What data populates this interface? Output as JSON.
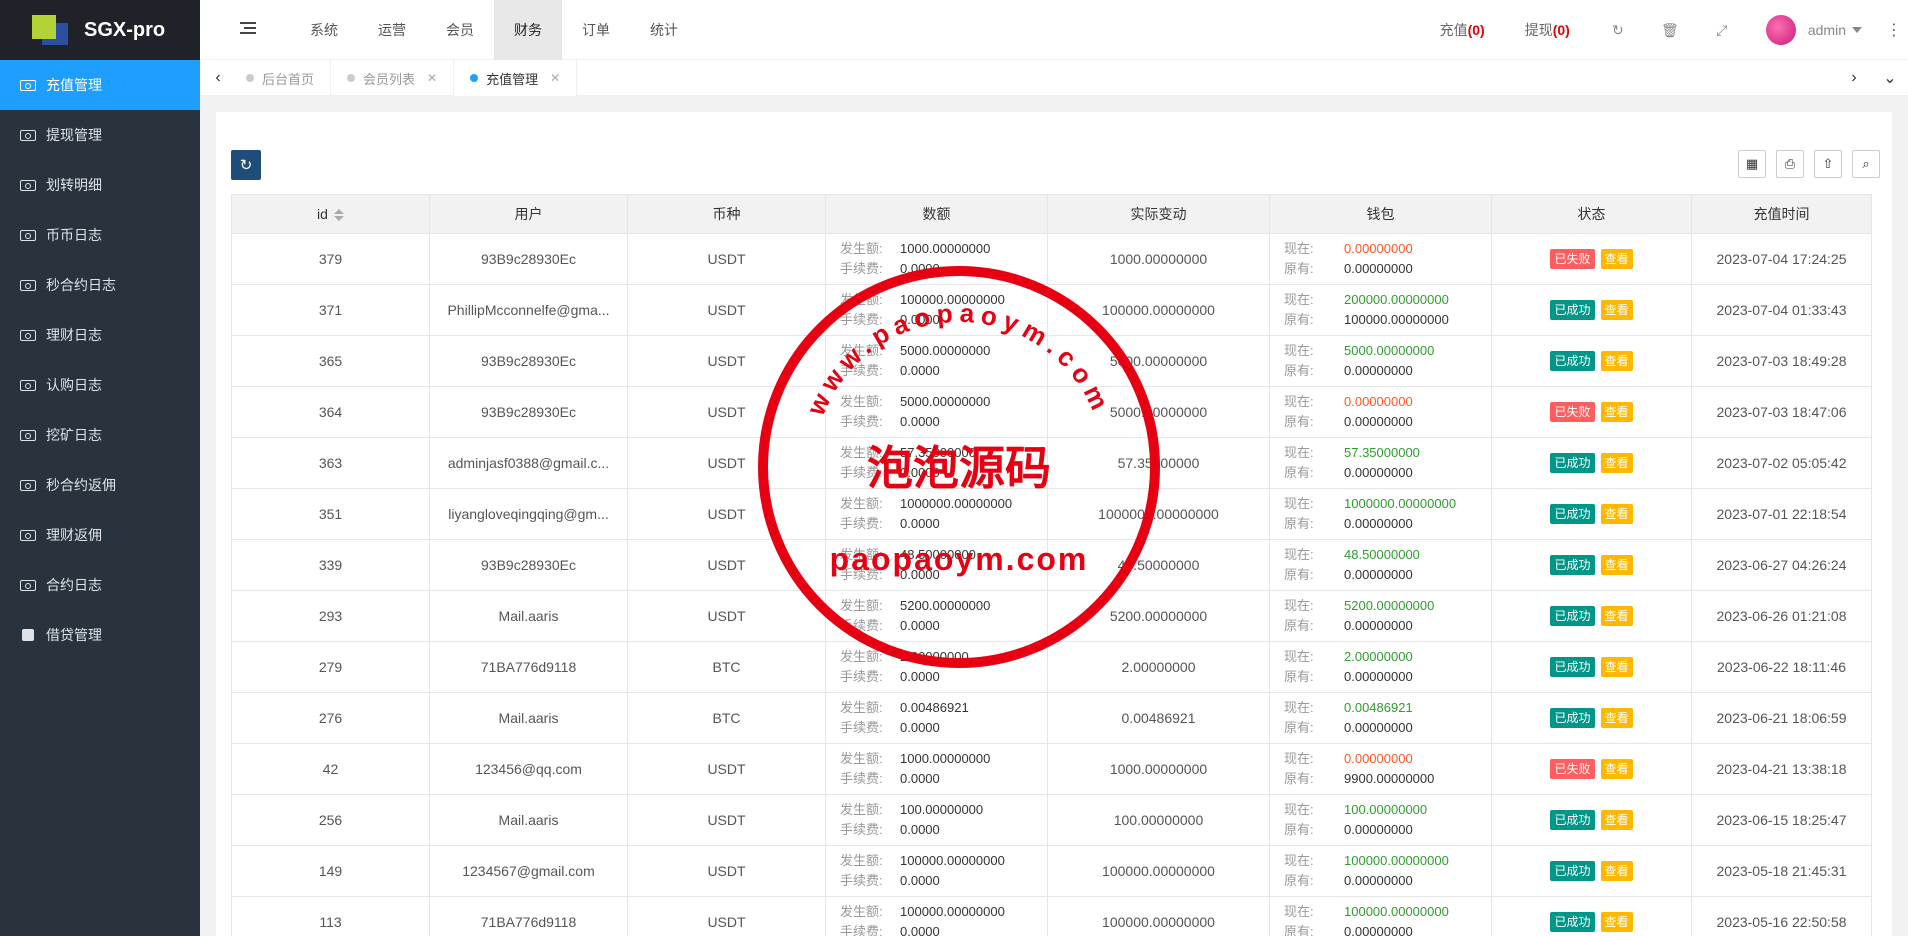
{
  "app": {
    "title": "SGX-pro"
  },
  "sidebar": {
    "items": [
      {
        "label": "充值管理",
        "active": true
      },
      {
        "label": "提现管理"
      },
      {
        "label": "划转明细"
      },
      {
        "label": "币币日志"
      },
      {
        "label": "秒合约日志"
      },
      {
        "label": "理财日志"
      },
      {
        "label": "认购日志"
      },
      {
        "label": "挖矿日志"
      },
      {
        "label": "秒合约返佣"
      },
      {
        "label": "理财返佣"
      },
      {
        "label": "合约日志"
      },
      {
        "label": "借贷管理"
      }
    ]
  },
  "topnav": {
    "items": [
      "系统",
      "运营",
      "会员",
      "财务",
      "订单",
      "统计"
    ],
    "active": "财务"
  },
  "header": {
    "recharge_label": "充值",
    "recharge_count": "(0)",
    "withdraw_label": "提现",
    "withdraw_count": "(0)",
    "user": "admin",
    "icons": [
      "refresh-icon",
      "trash-icon",
      "fullscreen-icon",
      "more-icon"
    ]
  },
  "tabs": [
    {
      "label": "后台首页",
      "closable": false
    },
    {
      "label": "会员列表",
      "closable": true
    },
    {
      "label": "充值管理",
      "closable": true,
      "active": true
    }
  ],
  "table": {
    "columns": [
      "id",
      "用户",
      "币种",
      "数额",
      "实际变动",
      "钱包",
      "状态",
      "充值时间"
    ],
    "amount_labels": {
      "occurred": "发生额:",
      "fee": "手续费:"
    },
    "wallet_labels": {
      "now": "现在:",
      "before": "原有:"
    },
    "status_labels": {
      "success": "已成功",
      "fail": "已失败",
      "view": "查看"
    },
    "rows": [
      {
        "id": "379",
        "user": "93B9c28930Ec",
        "coin": "USDT",
        "amount": "1000.00000000",
        "fee": "0.0000",
        "change": "1000.00000000",
        "now": "0.00000000",
        "before": "0.00000000",
        "status": "fail",
        "time": "2023-07-04 17:24:25"
      },
      {
        "id": "371",
        "user": "PhillipMcconnelfe@gma...",
        "coin": "USDT",
        "amount": "100000.00000000",
        "fee": "0.0000",
        "change": "100000.00000000",
        "now": "200000.00000000",
        "before": "100000.00000000",
        "status": "success",
        "time": "2023-07-04 01:33:43"
      },
      {
        "id": "365",
        "user": "93B9c28930Ec",
        "coin": "USDT",
        "amount": "5000.00000000",
        "fee": "0.0000",
        "change": "5000.00000000",
        "now": "5000.00000000",
        "before": "0.00000000",
        "status": "success",
        "time": "2023-07-03 18:49:28"
      },
      {
        "id": "364",
        "user": "93B9c28930Ec",
        "coin": "USDT",
        "amount": "5000.00000000",
        "fee": "0.0000",
        "change": "5000.00000000",
        "now": "0.00000000",
        "before": "0.00000000",
        "status": "fail",
        "time": "2023-07-03 18:47:06"
      },
      {
        "id": "363",
        "user": "adminjasf0388@gmail.c...",
        "coin": "USDT",
        "amount": "57.35000000",
        "fee": "0.0000",
        "change": "57.35000000",
        "now": "57.35000000",
        "before": "0.00000000",
        "status": "success",
        "time": "2023-07-02 05:05:42"
      },
      {
        "id": "351",
        "user": "liyangloveqingqing@gm...",
        "coin": "USDT",
        "amount": "1000000.00000000",
        "fee": "0.0000",
        "change": "1000000.00000000",
        "now": "1000000.00000000",
        "before": "0.00000000",
        "status": "success",
        "time": "2023-07-01 22:18:54"
      },
      {
        "id": "339",
        "user": "93B9c28930Ec",
        "coin": "USDT",
        "amount": "48.50000000",
        "fee": "0.0000",
        "change": "48.50000000",
        "now": "48.50000000",
        "before": "0.00000000",
        "status": "success",
        "time": "2023-06-27 04:26:24"
      },
      {
        "id": "293",
        "user": "Mail.aaris",
        "coin": "USDT",
        "amount": "5200.00000000",
        "fee": "0.0000",
        "change": "5200.00000000",
        "now": "5200.00000000",
        "before": "0.00000000",
        "status": "success",
        "time": "2023-06-26 01:21:08"
      },
      {
        "id": "279",
        "user": "71BA776d9118",
        "coin": "BTC",
        "amount": "2.00000000",
        "fee": "0.0000",
        "change": "2.00000000",
        "now": "2.00000000",
        "before": "0.00000000",
        "status": "success",
        "time": "2023-06-22 18:11:46"
      },
      {
        "id": "276",
        "user": "Mail.aaris",
        "coin": "BTC",
        "amount": "0.00486921",
        "fee": "0.0000",
        "change": "0.00486921",
        "now": "0.00486921",
        "before": "0.00000000",
        "status": "success",
        "time": "2023-06-21 18:06:59"
      },
      {
        "id": "42",
        "user": "123456@qq.com",
        "coin": "USDT",
        "amount": "1000.00000000",
        "fee": "0.0000",
        "change": "1000.00000000",
        "now": "0.00000000",
        "before": "9900.00000000",
        "status": "fail",
        "time": "2023-04-21 13:38:18"
      },
      {
        "id": "256",
        "user": "Mail.aaris",
        "coin": "USDT",
        "amount": "100.00000000",
        "fee": "0.0000",
        "change": "100.00000000",
        "now": "100.00000000",
        "before": "0.00000000",
        "status": "success",
        "time": "2023-06-15 18:25:47"
      },
      {
        "id": "149",
        "user": "1234567@gmail.com",
        "coin": "USDT",
        "amount": "100000.00000000",
        "fee": "0.0000",
        "change": "100000.00000000",
        "now": "100000.00000000",
        "before": "0.00000000",
        "status": "success",
        "time": "2023-05-18 21:45:31"
      },
      {
        "id": "113",
        "user": "71BA776d9118",
        "coin": "USDT",
        "amount": "100000.00000000",
        "fee": "0.0000",
        "change": "100000.00000000",
        "now": "100000.00000000",
        "before": "0.00000000",
        "status": "success",
        "time": "2023-05-16 22:50:58"
      }
    ]
  },
  "watermark": {
    "top_text": "www.paopaoym.com",
    "mid_text": "泡泡源码",
    "bottom_text": "paopaoym.com",
    "color": "#e60012"
  },
  "colors": {
    "accent": "#1e9fff",
    "sidebar": "#28333e",
    "success": "#009688",
    "fail": "#ff5e5e",
    "view": "#ffb800"
  }
}
